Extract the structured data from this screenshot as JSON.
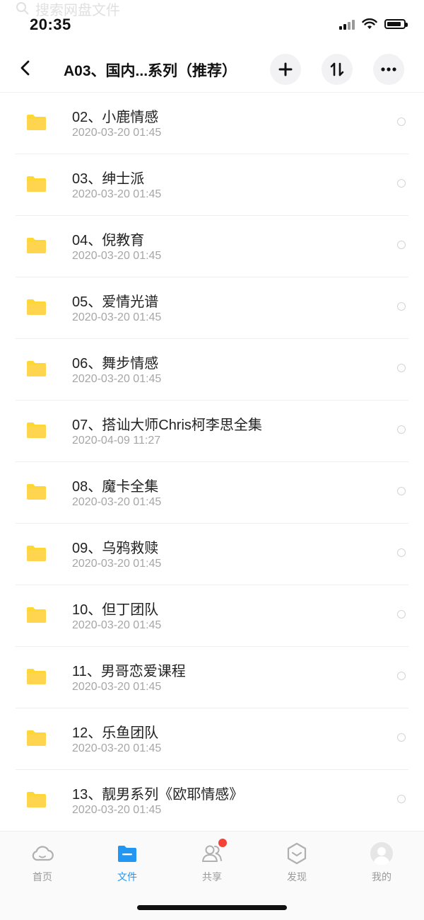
{
  "ghost_search": {
    "text": "搜索网盘文件"
  },
  "status_bar": {
    "time": "20:35",
    "battery_level": 0.85
  },
  "nav": {
    "title": "A03、国内...系列（推荐）",
    "back_icon": "chevron-left-icon",
    "actions": [
      {
        "name": "add-button",
        "icon": "plus-icon"
      },
      {
        "name": "sort-button",
        "icon": "sort-icon"
      },
      {
        "name": "more-button",
        "icon": "more-dots-icon"
      }
    ]
  },
  "files": [
    {
      "name": "02、小鹿情感",
      "date": "2020-03-20 01:45"
    },
    {
      "name": "03、绅士派",
      "date": "2020-03-20 01:45"
    },
    {
      "name": "04、倪教育",
      "date": "2020-03-20 01:45"
    },
    {
      "name": "05、爱情光谱",
      "date": "2020-03-20 01:45"
    },
    {
      "name": "06、舞步情感",
      "date": "2020-03-20 01:45"
    },
    {
      "name": "07、搭讪大师Chris柯李思全集",
      "date": "2020-04-09 11:27"
    },
    {
      "name": "08、魔卡全集",
      "date": "2020-03-20 01:45"
    },
    {
      "name": "09、乌鸦救赎",
      "date": "2020-03-20 01:45"
    },
    {
      "name": "10、但丁团队",
      "date": "2020-03-20 01:45"
    },
    {
      "name": "11、男哥恋爱课程",
      "date": "2020-03-20 01:45"
    },
    {
      "name": "12、乐鱼团队",
      "date": "2020-03-20 01:45"
    },
    {
      "name": "13、靓男系列《欧耶情感》",
      "date": "2020-03-20 01:45"
    }
  ],
  "tabs": [
    {
      "label": "首页",
      "icon": "cloud-icon",
      "active": false
    },
    {
      "label": "文件",
      "icon": "folder-icon",
      "active": true
    },
    {
      "label": "共享",
      "icon": "users-icon",
      "active": false,
      "badge": true
    },
    {
      "label": "发现",
      "icon": "discover-box-icon",
      "active": false
    },
    {
      "label": "我的",
      "icon": "avatar-icon",
      "active": false
    }
  ],
  "colors": {
    "accent": "#2196f3",
    "folder": "#fdd835",
    "badge": "#f44336"
  }
}
